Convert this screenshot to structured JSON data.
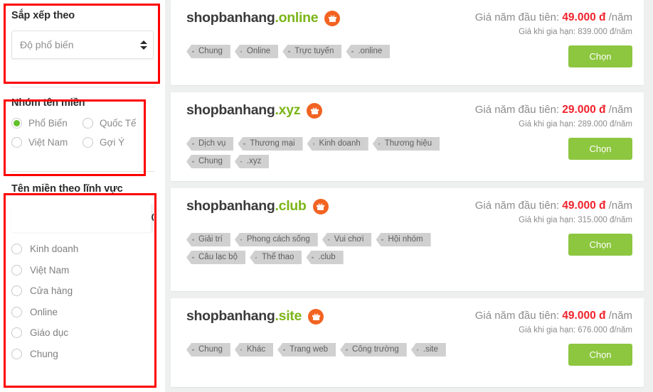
{
  "sidebar": {
    "sort": {
      "title": "Sắp xếp theo",
      "selected": "Độ phổ biến",
      "spinner_icon": "spinner-updown-icon"
    },
    "domain_group": {
      "title": "Nhóm tên miền",
      "options": [
        {
          "label": "Phổ Biến",
          "selected": true
        },
        {
          "label": "Quốc Tế",
          "selected": false
        },
        {
          "label": "Việt Nam",
          "selected": false
        },
        {
          "label": "Gợi Ý",
          "selected": false
        }
      ]
    },
    "by_field": {
      "title": "Tên miền theo lĩnh vực",
      "search_value": "",
      "search_placeholder": "",
      "search_icon": "search-icon",
      "options": [
        {
          "label": "Kinh doanh",
          "selected": false
        },
        {
          "label": "Việt Nam",
          "selected": false
        },
        {
          "label": "Cửa hàng",
          "selected": false
        },
        {
          "label": "Online",
          "selected": false
        },
        {
          "label": "Giáo dục",
          "selected": false
        },
        {
          "label": "Chung",
          "selected": false
        }
      ]
    }
  },
  "results": {
    "choose_label": "Chọn",
    "price_first_label": "Giá năm đầu tiên:",
    "per_year": "/năm",
    "gift_icon": "gift-icon",
    "cards": [
      {
        "sld": "shopbanhang",
        "tld": ".online",
        "price_first": "49.000 đ",
        "price_renew": "Giá khi gia hạn: 839.000 đ/năm",
        "tags": [
          "Chung",
          "Online",
          "Trực tuyến",
          ".online"
        ]
      },
      {
        "sld": "shopbanhang",
        "tld": ".xyz",
        "price_first": "29.000 đ",
        "price_renew": "Giá khi gia hạn: 289.000 đ/năm",
        "tags": [
          "Dịch vụ",
          "Thương mại",
          "Kinh doanh",
          "Thương hiệu",
          "Chung",
          ".xyz"
        ]
      },
      {
        "sld": "shopbanhang",
        "tld": ".club",
        "price_first": "49.000 đ",
        "price_renew": "Giá khi gia hạn: 315.000 đ/năm",
        "tags": [
          "Giải trí",
          "Phong cách sống",
          "Vui chơi",
          "Hội nhóm",
          "Câu lạc bộ",
          "Thể thao",
          ".club"
        ]
      },
      {
        "sld": "shopbanhang",
        "tld": ".site",
        "price_first": "49.000 đ",
        "price_renew": "Giá khi gia hạn: 676.000 đ/năm",
        "tags": [
          "Chung",
          "Khác",
          "Trang web",
          "Công trường",
          ".site"
        ]
      }
    ]
  },
  "colors": {
    "accent_green": "#8dc63f",
    "tld_green": "#7cb518",
    "price_red": "#f0222c",
    "gift_orange": "#f26322",
    "annotation_red": "#ff0000"
  }
}
